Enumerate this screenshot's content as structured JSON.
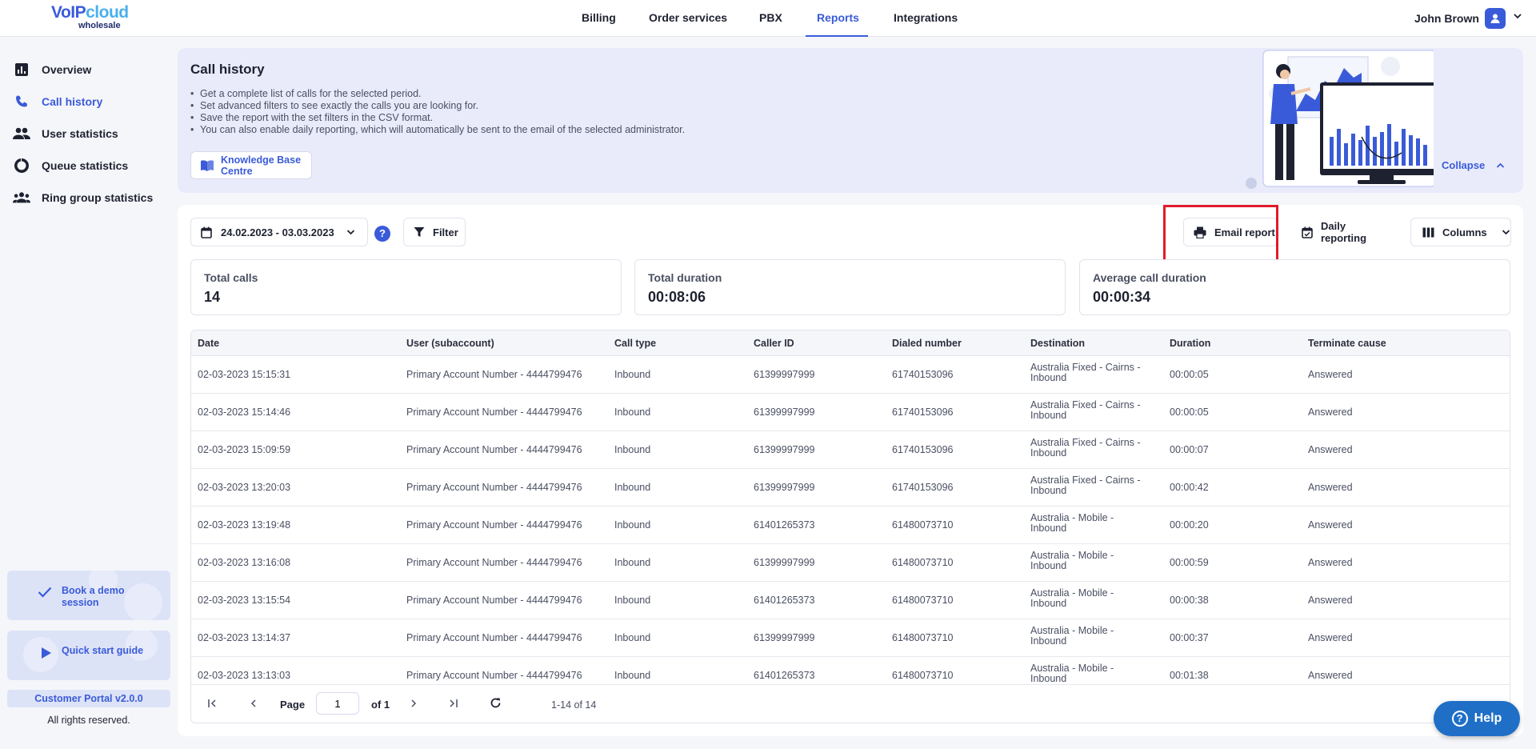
{
  "brand": {
    "line1a": "VoIP",
    "line1b": "cloud",
    "line2": "wholesale"
  },
  "nav": {
    "billing": "Billing",
    "order_services": "Order services",
    "pbx": "PBX",
    "reports": "Reports",
    "integrations": "Integrations"
  },
  "user": {
    "name": "John Brown"
  },
  "sidebar": {
    "items": [
      {
        "label": "Overview"
      },
      {
        "label": "Call history"
      },
      {
        "label": "User statistics"
      },
      {
        "label": "Queue statistics"
      },
      {
        "label": "Ring group statistics"
      }
    ],
    "demo": "Book a demo session",
    "quickstart": "Quick start guide",
    "version": "Customer Portal v2.0.0",
    "rights": "All rights reserved."
  },
  "banner": {
    "title": "Call history",
    "bullets": [
      "Get a complete list of calls for the selected period.",
      "Set advanced filters to see exactly the calls you are looking for.",
      "Save the report with the set filters in the CSV format.",
      "You can also enable daily reporting, which will automatically be sent to the email of the selected administrator."
    ],
    "kb_button": "Knowledge Base Centre",
    "collapse": "Collapse"
  },
  "toolbar": {
    "date_range": "24.02.2023 - 03.03.2023",
    "help": "?",
    "filter": "Filter",
    "email_report": "Email report",
    "daily_reporting": "Daily reporting",
    "columns": "Columns"
  },
  "stats": {
    "total_calls_label": "Total calls",
    "total_calls": "14",
    "total_duration_label": "Total duration",
    "total_duration": "00:08:06",
    "avg_duration_label": "Average call duration",
    "avg_duration": "00:00:34"
  },
  "table": {
    "headers": [
      "Date",
      "User (subaccount)",
      "Call type",
      "Caller ID",
      "Dialed number",
      "Destination",
      "Duration",
      "Terminate cause"
    ],
    "rows": [
      [
        "02-03-2023 15:15:31",
        "Primary Account Number - 4444799476",
        "Inbound",
        "61399997999",
        "61740153096",
        "Australia Fixed - Cairns - Inbound",
        "00:00:05",
        "Answered"
      ],
      [
        "02-03-2023 15:14:46",
        "Primary Account Number - 4444799476",
        "Inbound",
        "61399997999",
        "61740153096",
        "Australia Fixed - Cairns - Inbound",
        "00:00:05",
        "Answered"
      ],
      [
        "02-03-2023 15:09:59",
        "Primary Account Number - 4444799476",
        "Inbound",
        "61399997999",
        "61740153096",
        "Australia Fixed - Cairns - Inbound",
        "00:00:07",
        "Answered"
      ],
      [
        "02-03-2023 13:20:03",
        "Primary Account Number - 4444799476",
        "Inbound",
        "61399997999",
        "61740153096",
        "Australia Fixed - Cairns - Inbound",
        "00:00:42",
        "Answered"
      ],
      [
        "02-03-2023 13:19:48",
        "Primary Account Number - 4444799476",
        "Inbound",
        "61401265373",
        "61480073710",
        "Australia - Mobile - Inbound",
        "00:00:20",
        "Answered"
      ],
      [
        "02-03-2023 13:16:08",
        "Primary Account Number - 4444799476",
        "Inbound",
        "61399997999",
        "61480073710",
        "Australia - Mobile - Inbound",
        "00:00:59",
        "Answered"
      ],
      [
        "02-03-2023 13:15:54",
        "Primary Account Number - 4444799476",
        "Inbound",
        "61401265373",
        "61480073710",
        "Australia - Mobile - Inbound",
        "00:00:38",
        "Answered"
      ],
      [
        "02-03-2023 13:14:37",
        "Primary Account Number - 4444799476",
        "Inbound",
        "61399997999",
        "61480073710",
        "Australia - Mobile - Inbound",
        "00:00:37",
        "Answered"
      ],
      [
        "02-03-2023 13:13:03",
        "Primary Account Number - 4444799476",
        "Inbound",
        "61401265373",
        "61480073710",
        "Australia - Mobile - Inbound",
        "00:01:38",
        "Answered"
      ]
    ]
  },
  "pager": {
    "page_label": "Page",
    "page_value": "1",
    "of_label": "of 1",
    "range": "1-14 of 14"
  },
  "help_fab": "Help",
  "colors": {
    "accent": "#3a5bd9",
    "highlight": "#e01b2b",
    "help": "#1f6fc7"
  }
}
